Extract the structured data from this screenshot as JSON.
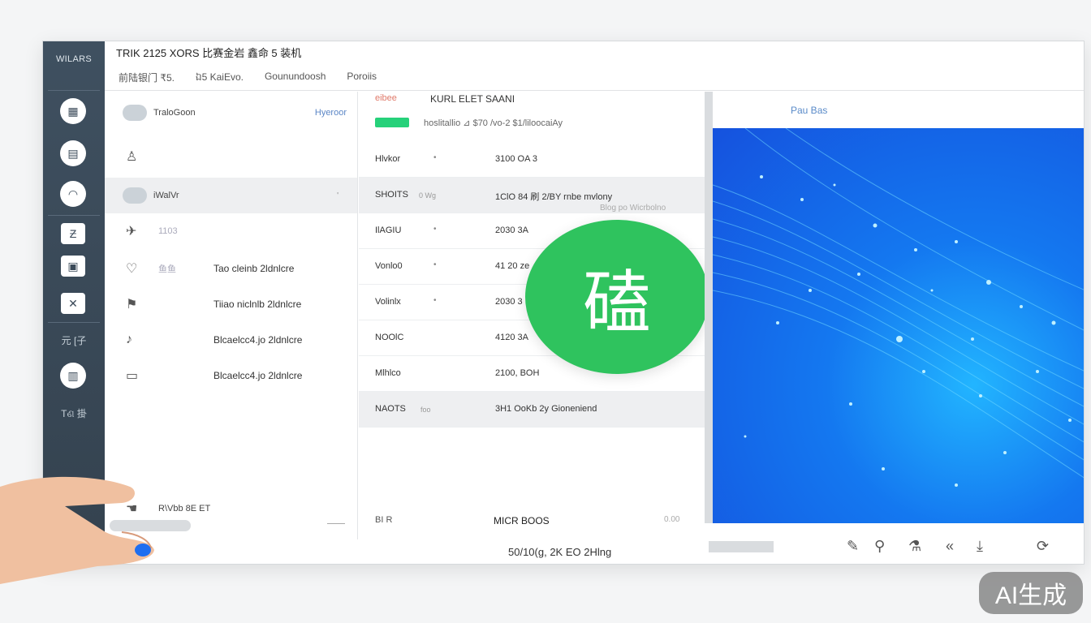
{
  "window": {
    "brand": "WILARS",
    "title": "TRIK 2125 XORS  比赛金岩 鑫命 5 装机",
    "subnav": [
      "前陆银门 ₹5.",
      "ឯ5 KaiEvo.",
      "Gounundoosh",
      "Poroiis"
    ]
  },
  "rail": {
    "icons": [
      "table-icon",
      "grid-icon",
      "dome-icon",
      "tile-icon",
      "box-icon",
      "cross-icon"
    ],
    "label_a": "元 [子",
    "label_b": "Tଣ 掛",
    "icon_glyph_a": "▦",
    "icon_glyph_b": "▤",
    "icon_glyph_c": "◠",
    "icon_glyph_d": "Ƶ",
    "icon_glyph_e": "▣",
    "icon_glyph_f": "✕",
    "icon_glyph_g": "▥",
    "bottom_glyph": "⌂"
  },
  "leftlist": {
    "items": [
      {
        "icon": "cloud-icon",
        "label": "TraloGoon",
        "right": "Hyeroor"
      },
      {
        "icon": "person-icon",
        "label": ""
      },
      {
        "icon": "cloud-icon",
        "label": "iWalVr",
        "right": "'"
      },
      {
        "icon": "pin-icon",
        "label": "1103"
      },
      {
        "icon": "heart-icon",
        "label": "鱼鱼",
        "label2": "Tao cleinb 2ldnlcre"
      },
      {
        "icon": "bookmark-icon",
        "label": "",
        "label2": "Tiiao niclnlb 2ldnlcre"
      },
      {
        "icon": "bell-icon",
        "label": "",
        "label2": "Blcaelcc4.jo 2ldnlcre"
      },
      {
        "icon": "card-icon",
        "label": "",
        "label2": "Blcaelcc4.jo 2ldnlcre"
      }
    ],
    "footer_label": "R\\Vbb 8E ET"
  },
  "table": {
    "tag": "eibee",
    "header": "KURL   ELET SAANI",
    "progress_label": "hoslitallio  ⊿  $70 /vo-2 $1/liloocaiAy",
    "rows": [
      {
        "c1": "Hlvkor",
        "c2": "3100  OA 3"
      },
      {
        "c1": "SHOITS",
        "tag": "0 Wg",
        "c2": "1ClO  84 刷 2/BY  rnbe mvlony"
      },
      {
        "c1": "IlAGIU",
        "c2": "2030  3A"
      },
      {
        "c1": "Vonlo0",
        "c2": "41 20  ze"
      },
      {
        "c1": "Volinlx",
        "c2": "2030  3"
      },
      {
        "c1": "NOOlC",
        "c2": "4120  3A"
      },
      {
        "c1": "Mlhlco",
        "c2": "2100,  BOH"
      },
      {
        "c1": "NAOTS",
        "tag": "foo",
        "c2": "3H1  OoKb 2y  Gioneniend"
      }
    ],
    "hint": "Blog po Wicrbolno",
    "footer_left": "BI R",
    "footer_mid": "MICR  BOOS",
    "footer_right": "0.00",
    "footer_bottom": "50/10(g, 2K EO  2Hlng"
  },
  "badge": {
    "glyph": "磕",
    "color": "#2fc35e"
  },
  "image_panel": {
    "title": "Pau Bas"
  },
  "toolbar": {
    "icons": [
      "settings-icon",
      "key-icon",
      "flask-icon",
      "chevron-icon",
      "download-icon",
      "refresh-icon",
      "info-icon"
    ],
    "glyph_a": "✎",
    "glyph_b": "⚲",
    "glyph_c": "⚗",
    "glyph_d": "«",
    "glyph_e": "⤓",
    "glyph_f": "⟳",
    "glyph_g": "ⓘ"
  },
  "watermark": "AI生成",
  "colors": {
    "accent": "#26d17a",
    "rail": "#3f5060",
    "image_blue": "#1478f0"
  }
}
